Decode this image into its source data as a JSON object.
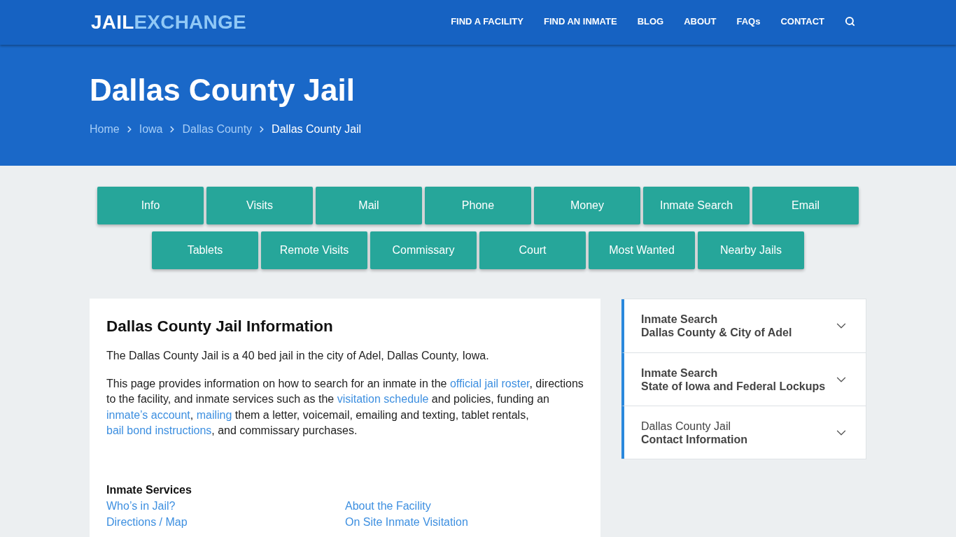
{
  "header": {
    "logo": {
      "first": "JAIL",
      "second": "EXCHANGE"
    },
    "nav": [
      "FIND A FACILITY",
      "FIND AN INMATE",
      "BLOG",
      "ABOUT",
      "FAQs",
      "CONTACT"
    ]
  },
  "hero": {
    "title": "Dallas County Jail",
    "breadcrumbs": [
      {
        "label": "Home",
        "current": false
      },
      {
        "label": "Iowa",
        "current": false
      },
      {
        "label": "Dallas County",
        "current": false
      },
      {
        "label": "Dallas County Jail",
        "current": true
      }
    ]
  },
  "button_rows": [
    {
      "buttons": [
        "Info",
        "Visits",
        "Mail",
        "Phone",
        "Money",
        "Inmate Search",
        "Email"
      ]
    },
    {
      "buttons": [
        "Tablets",
        "Remote Visits",
        "Commissary",
        "Court",
        "Most Wanted",
        "Nearby Jails"
      ]
    }
  ],
  "info_card": {
    "heading": "Dallas County Jail Information",
    "paragraphs": [
      [
        {
          "kind": "text",
          "text": "The Dallas County Jail is a 40 bed jail in the city of Adel, Dallas County, Iowa."
        }
      ],
      [
        {
          "kind": "text",
          "text": "This page provides information on how to search for an inmate in the "
        },
        {
          "kind": "link",
          "text": "official jail roster"
        },
        {
          "kind": "text",
          "text": ", directions to the facility, and inmate services such as the "
        },
        {
          "kind": "link",
          "text": "visitation schedule"
        },
        {
          "kind": "text",
          "text": " and policies, funding an "
        },
        {
          "kind": "link",
          "text": "inmate’s account"
        },
        {
          "kind": "text",
          "text": ", "
        },
        {
          "kind": "link",
          "text": "mailing"
        },
        {
          "kind": "text",
          "text": " them a letter, voicemail, emailing and texting, tablet rentals, "
        },
        {
          "kind": "link",
          "text": "bail bond instructions"
        },
        {
          "kind": "text",
          "text": ", and commissary purchases."
        }
      ]
    ],
    "services": {
      "heading": "Inmate Services",
      "columns": [
        [
          "Who’s in Jail?",
          "Directions / Map"
        ],
        [
          "About the Facility",
          "On Site Inmate Visitation"
        ]
      ]
    }
  },
  "sidebar": {
    "items": [
      {
        "title": "Inmate Search",
        "title_bold": true,
        "subtitle": "Dallas County & City of Adel",
        "expanded": false
      },
      {
        "title": "Inmate Search",
        "title_bold": true,
        "subtitle": "State of Iowa and Federal Lockups",
        "expanded": false
      },
      {
        "title": "Dallas County Jail",
        "title_bold": false,
        "subtitle": "Contact Information",
        "expanded": false
      }
    ]
  }
}
